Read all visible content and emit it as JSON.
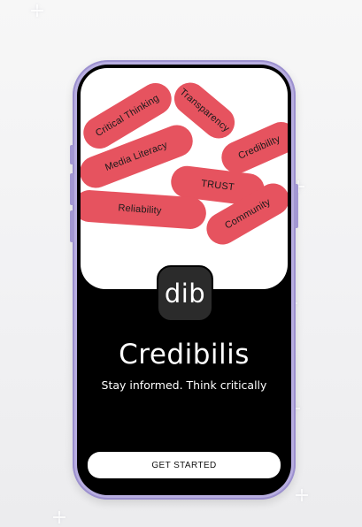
{
  "colors": {
    "pill": "#e6535f",
    "screen_background": "#000000",
    "card_background": "#ffffff",
    "phone_frame": "#b8aee0"
  },
  "tags": [
    {
      "label": "Critical Thinking"
    },
    {
      "label": "Transparency"
    },
    {
      "label": "Credibility"
    },
    {
      "label": "Media Literacy"
    },
    {
      "label": "TRUST"
    },
    {
      "label": "Reliability"
    },
    {
      "label": "Community"
    }
  ],
  "logo": {
    "text": "dib"
  },
  "app": {
    "title": "Credibilis",
    "tagline": "Stay informed. Think critically"
  },
  "cta": {
    "label": "GET STARTED"
  }
}
